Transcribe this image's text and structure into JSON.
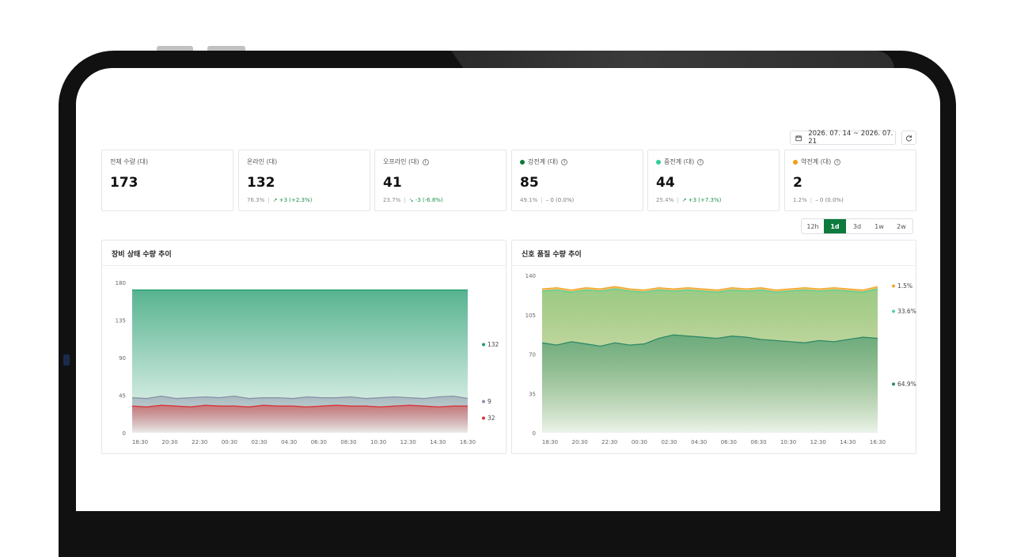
{
  "toolbar": {
    "date_range": "2026. 07. 14 ~ 2026. 07. 21",
    "icons": {
      "calendar": "calendar-icon",
      "refresh": "refresh-icon"
    }
  },
  "stats": [
    {
      "label": "전체 수량 (대)",
      "value": "173",
      "dot": null,
      "info": false,
      "percent": "",
      "delta": ""
    },
    {
      "label": "온라인 (대)",
      "value": "132",
      "dot": null,
      "info": false,
      "percent": "76.3%",
      "delta": "+3 (+2.3%)",
      "trend": "up"
    },
    {
      "label": "오프라인 (대)",
      "value": "41",
      "dot": null,
      "info": true,
      "percent": "23.7%",
      "delta": "-3 (-6.8%)",
      "trend": "down"
    },
    {
      "label": "강전계 (대)",
      "value": "85",
      "dot": "#0d7a3e",
      "info": true,
      "percent": "49.1%",
      "delta": "0 (0.0%)",
      "trend": "flat"
    },
    {
      "label": "중전계 (대)",
      "value": "44",
      "dot": "#2ecf9a",
      "info": true,
      "percent": "25.4%",
      "delta": "+3 (+7.3%)",
      "trend": "up"
    },
    {
      "label": "약전계 (대)",
      "value": "2",
      "dot": "#f39c12",
      "info": true,
      "percent": "1.2%",
      "delta": "0 (0.0%)",
      "trend": "flat"
    }
  ],
  "ranges": [
    "12h",
    "1d",
    "3d",
    "1w",
    "2w"
  ],
  "active_range": "1d",
  "x_ticks": [
    "18:30",
    "20:30",
    "22:30",
    "00:30",
    "02:30",
    "04:30",
    "06:30",
    "08:30",
    "10:30",
    "12:30",
    "14:30",
    "16:30"
  ],
  "chart_data": [
    {
      "type": "area",
      "title": "장비 상태 수량 추이",
      "ylim": [
        0,
        180
      ],
      "yticks": [
        0,
        45,
        90,
        135,
        180
      ],
      "series": [
        {
          "color": "#1f9a6b",
          "end_label": "132",
          "values": [
            171,
            171,
            171,
            171,
            171,
            171,
            171,
            171,
            171,
            171,
            171,
            171,
            171,
            171,
            171,
            171,
            171,
            171,
            171,
            171,
            171,
            171,
            171,
            171
          ]
        },
        {
          "color": "#8a93a6",
          "end_label": "9",
          "values": [
            42,
            41,
            44,
            41,
            42,
            43,
            42,
            44,
            41,
            42,
            42,
            41,
            43,
            42,
            42,
            43,
            41,
            42,
            43,
            42,
            41,
            43,
            44,
            41
          ]
        },
        {
          "color": "#d6373a",
          "end_label": "32",
          "values": [
            32,
            31,
            33,
            32,
            31,
            33,
            32,
            32,
            31,
            33,
            32,
            32,
            31,
            32,
            33,
            32,
            32,
            31,
            32,
            33,
            32,
            31,
            32,
            32
          ]
        }
      ]
    },
    {
      "type": "area",
      "title": "신호 품질 수량 추이",
      "ylim": [
        0,
        140
      ],
      "yticks": [
        0,
        35,
        70,
        105,
        140
      ],
      "series": [
        {
          "color": "#f0a830",
          "end_label": "1.5%",
          "values": [
            128,
            129,
            127,
            129,
            128,
            130,
            128,
            127,
            129,
            128,
            129,
            128,
            127,
            129,
            128,
            129,
            127,
            128,
            129,
            128,
            129,
            128,
            127,
            130
          ]
        },
        {
          "color": "#52d49c",
          "end_label": "33.6%",
          "values": [
            126,
            127,
            125,
            127,
            126,
            128,
            126,
            125,
            127,
            126,
            127,
            126,
            125,
            127,
            126,
            127,
            125,
            126,
            127,
            126,
            127,
            126,
            125,
            128
          ]
        },
        {
          "color": "#2f8a66",
          "end_label": "64.9%",
          "values": [
            80,
            78,
            81,
            79,
            77,
            80,
            78,
            79,
            84,
            87,
            86,
            85,
            84,
            86,
            85,
            83,
            82,
            81,
            80,
            82,
            81,
            83,
            85,
            84
          ]
        }
      ]
    }
  ]
}
